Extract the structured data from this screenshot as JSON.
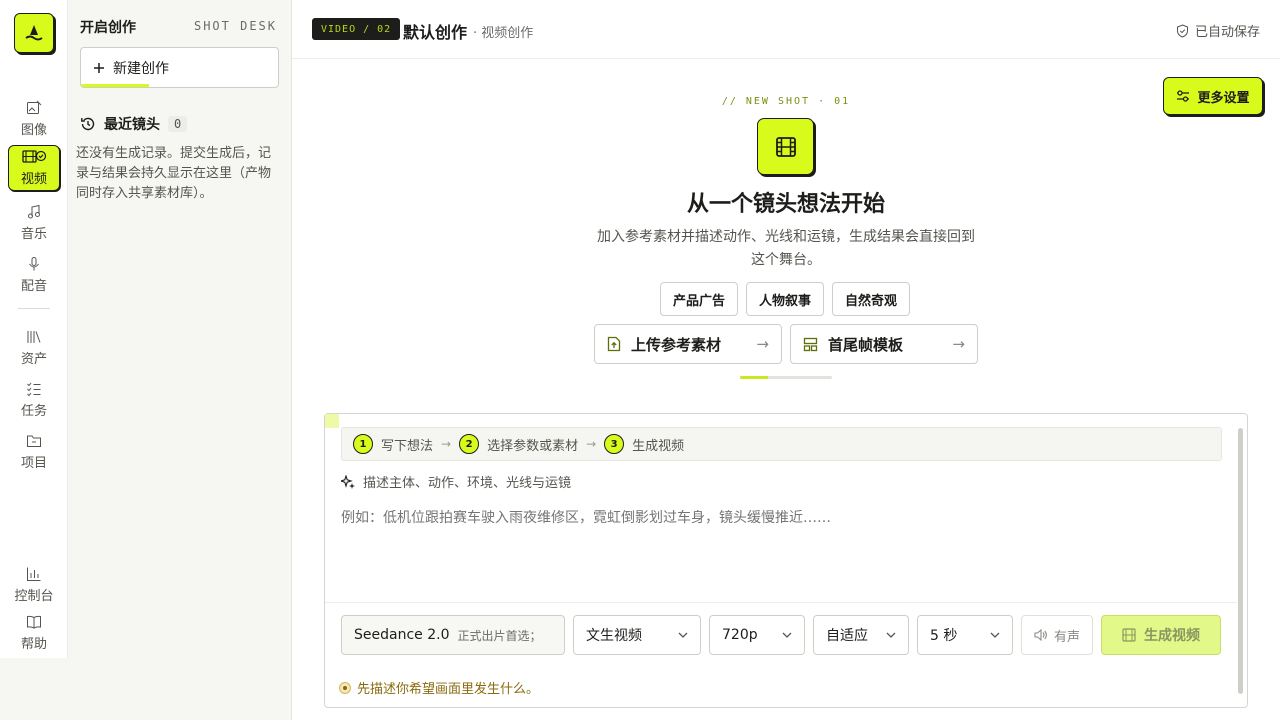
{
  "rail": {
    "items": [
      {
        "key": "image",
        "label": "图像",
        "icon": "image-edit-icon"
      },
      {
        "key": "video",
        "label": "视频",
        "icon": "film-icon",
        "active": true
      },
      {
        "key": "music",
        "label": "音乐",
        "icon": "music-note-icon"
      },
      {
        "key": "voice",
        "label": "配音",
        "icon": "microphone-icon"
      },
      {
        "key": "assets",
        "label": "资产",
        "icon": "library-icon"
      },
      {
        "key": "tasks",
        "label": "任务",
        "icon": "checklist-icon"
      },
      {
        "key": "projects",
        "label": "项目",
        "icon": "folder-icon"
      },
      {
        "key": "dashboard",
        "label": "控制台",
        "icon": "bar-chart-icon"
      },
      {
        "key": "help",
        "label": "帮助",
        "icon": "book-icon"
      }
    ]
  },
  "panel": {
    "title": "开启创作",
    "tag": "SHOT DESK",
    "new_label": "新建创作",
    "recent_title": "最近镜头",
    "recent_count": "0",
    "empty_text": "还没有生成记录。提交生成后，记录与结果会持久显示在这里（产物同时存入共享素材库）。"
  },
  "topbar": {
    "chip": "VIDEO / 02",
    "title": "默认创作",
    "subtitle": "· 视频创作",
    "autosave": "已自动保存"
  },
  "stage": {
    "settings_label": "更多设置",
    "kicker": "// NEW SHOT · 01",
    "title": "从一个镜头想法开始",
    "desc": "加入参考素材并描述动作、光线和运镜，生成结果会直接回到这个舞台。",
    "chips": [
      "产品广告",
      "人物叙事",
      "自然奇观"
    ],
    "upload_label": "上传参考素材",
    "template_label": "首尾帧模板",
    "progress": 0.3
  },
  "composer": {
    "steps": [
      {
        "num": "1",
        "label": "写下想法"
      },
      {
        "num": "2",
        "label": "选择参数或素材"
      },
      {
        "num": "3",
        "label": "生成视频"
      }
    ],
    "hint": "描述主体、动作、环境、光线与运镜",
    "placeholder": "例如：低机位跟拍赛车驶入雨夜维修区，霓虹倒影划过车身，镜头缓慢推近……",
    "model": "Seedance 2.0",
    "model_sub": "正式出片首选；",
    "mode": "文生视频",
    "resolution": "720p",
    "ratio": "自适应",
    "duration": "5 秒",
    "sound_label": "有声",
    "generate_label": "生成视频",
    "warning": "先描述你希望画面里发生什么。"
  },
  "colors": {
    "accent": "#d8fb1c",
    "ink": "#1d1d1b",
    "panel_bg": "#f6f6f3"
  }
}
